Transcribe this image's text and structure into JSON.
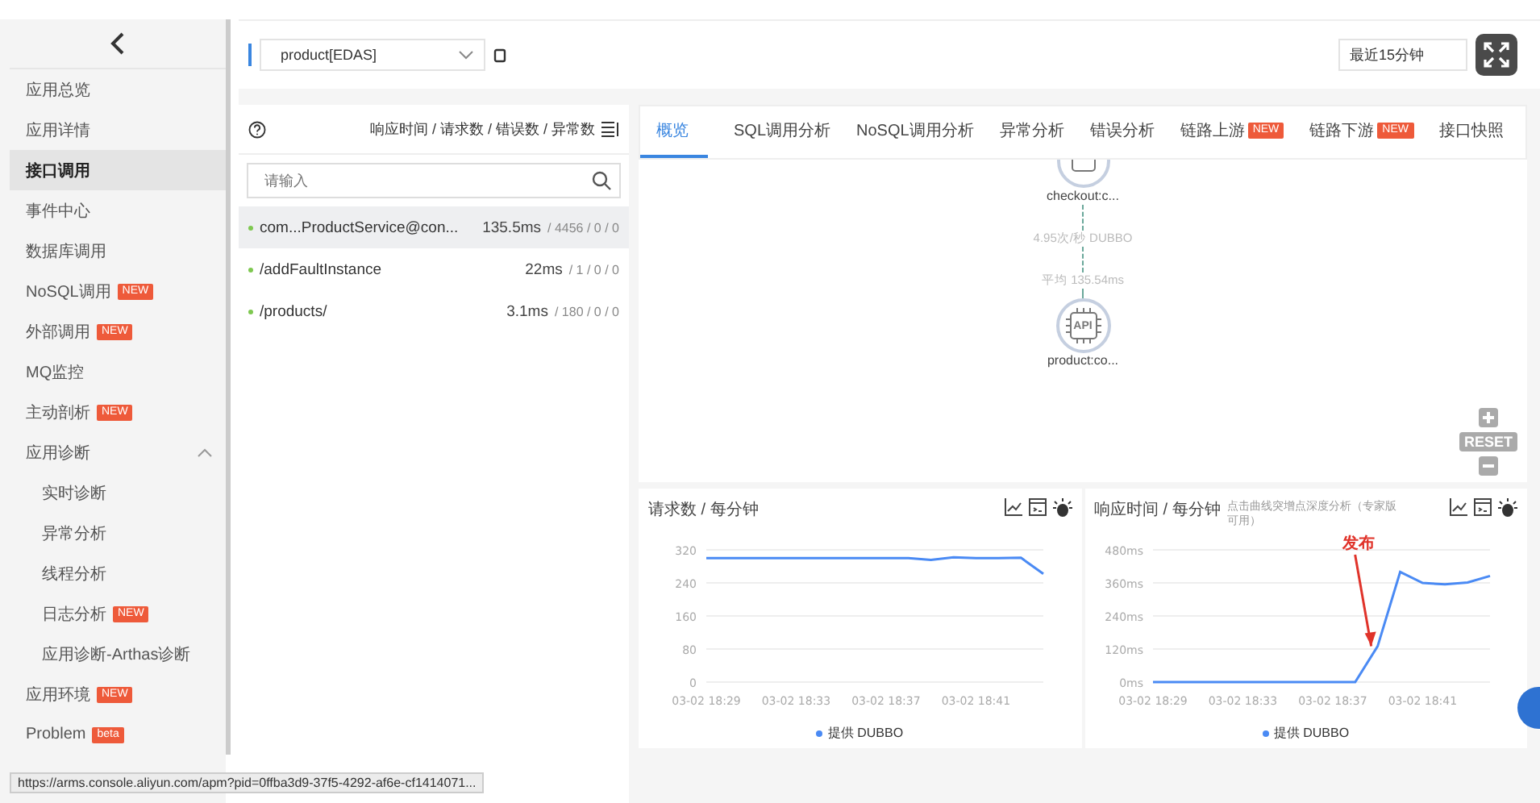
{
  "sidebar": {
    "items": [
      {
        "label": "应用总览",
        "selected": false
      },
      {
        "label": "应用详情",
        "selected": false
      },
      {
        "label": "接口调用",
        "selected": true
      },
      {
        "label": "事件中心",
        "selected": false
      },
      {
        "label": "数据库调用",
        "selected": false
      },
      {
        "label": "NoSQL调用",
        "badge": "NEW",
        "selected": false
      },
      {
        "label": "外部调用",
        "badge": "NEW",
        "selected": false
      },
      {
        "label": "MQ监控",
        "selected": false
      },
      {
        "label": "主动剖析",
        "badge": "NEW",
        "selected": false
      },
      {
        "label": "应用诊断",
        "selected": false,
        "expanded": true,
        "children": [
          {
            "label": "实时诊断",
            "selected": false
          },
          {
            "label": "异常分析",
            "selected": false
          },
          {
            "label": "线程分析",
            "selected": false
          },
          {
            "label": "日志分析",
            "badge": "NEW",
            "selected": false
          },
          {
            "label": "应用诊断-Arthas诊断",
            "selected": false
          }
        ]
      },
      {
        "label": "应用环境",
        "badge": "NEW",
        "selected": false
      },
      {
        "label": "Problem",
        "badge": "beta",
        "selected": false
      }
    ]
  },
  "topbar": {
    "app_select": "product[EDAS]",
    "time_select": "最近15分钟"
  },
  "interface_panel": {
    "metrics_header": "响应时间 / 请求数 / 错误数 / 异常数",
    "search": {
      "placeholder": "请输入"
    },
    "rows": [
      {
        "name": "com...ProductService@con...",
        "time": "135.5ms",
        "counts": "/ 4456 / 0 / 0",
        "color": "#7ec850",
        "selected": true
      },
      {
        "name": "/addFaultInstance",
        "time": "22ms",
        "counts": "/ 1 / 0 / 0",
        "color": "#7ec850",
        "selected": false
      },
      {
        "name": "/products/",
        "time": "3.1ms",
        "counts": "/ 180 / 0 / 0",
        "color": "#7ec850",
        "selected": false
      }
    ]
  },
  "tabs": [
    {
      "label": "概览",
      "selected": true
    },
    {
      "label": "SQL调用分析",
      "selected": false
    },
    {
      "label": "NoSQL调用分析",
      "selected": false
    },
    {
      "label": "异常分析",
      "selected": false
    },
    {
      "label": "错误分析",
      "selected": false
    },
    {
      "label": "链路上游",
      "badge": "NEW",
      "selected": false
    },
    {
      "label": "链路下游",
      "badge": "NEW",
      "selected": false
    },
    {
      "label": "接口快照",
      "selected": false
    }
  ],
  "topology": {
    "nodes": [
      {
        "label": "checkout:c..."
      },
      {
        "label": "product:co...",
        "icon_text": "API"
      }
    ],
    "edge_rate": "4.95次/秒 DUBBO",
    "edge_avg": "平均 135.54ms",
    "reset": "RESET"
  },
  "charts": [
    {
      "title": "请求数 / 每分钟",
      "chart_data": {
        "type": "line",
        "grid": true,
        "categories": [
          "03-02 18:29",
          null,
          null,
          null,
          "03-02 18:33",
          null,
          null,
          null,
          "03-02 18:37",
          null,
          null,
          null,
          "03-02 18:41",
          null,
          null,
          null
        ],
        "series": [
          {
            "name": "提供 DUBBO",
            "color": "#4a8af4",
            "values": [
              300,
              300,
              300,
              300,
              300,
              300,
              300,
              300,
              300,
              300,
              296,
              302,
              300,
              300,
              301,
              262
            ]
          }
        ],
        "ylim": [
          0,
          320
        ],
        "yticks": [
          0,
          80,
          160,
          240,
          320
        ]
      }
    },
    {
      "title": "响应时间 / 每分钟",
      "subtitle": "点击曲线突增点深度分析（专家版可用）",
      "chart_data": {
        "type": "line",
        "grid": true,
        "categories": [
          "03-02 18:29",
          null,
          null,
          null,
          "03-02 18:33",
          null,
          null,
          null,
          "03-02 18:37",
          null,
          null,
          null,
          "03-02 18:41",
          null,
          null,
          null
        ],
        "series": [
          {
            "name": "提供 DUBBO",
            "color": "#4a8af4",
            "values": [
              0,
              0,
              0,
              0,
              0,
              0,
              0,
              0,
              0,
              0,
              130,
              400,
              360,
              355,
              362,
              385
            ]
          }
        ],
        "ylim": [
          0,
          480
        ],
        "yticks": [
          {
            "value": 0,
            "label": "0ms"
          },
          {
            "value": 120,
            "label": "120ms"
          },
          {
            "value": 240,
            "label": "240ms"
          },
          {
            "value": 360,
            "label": "360ms"
          },
          {
            "value": 480,
            "label": "480ms"
          }
        ],
        "annotations": [
          {
            "text": "发布"
          }
        ]
      }
    }
  ],
  "status_url": "https://arms.console.aliyun.com/apm?pid=0ffba3d9-37f5-4292-af6e-cf1414071..."
}
